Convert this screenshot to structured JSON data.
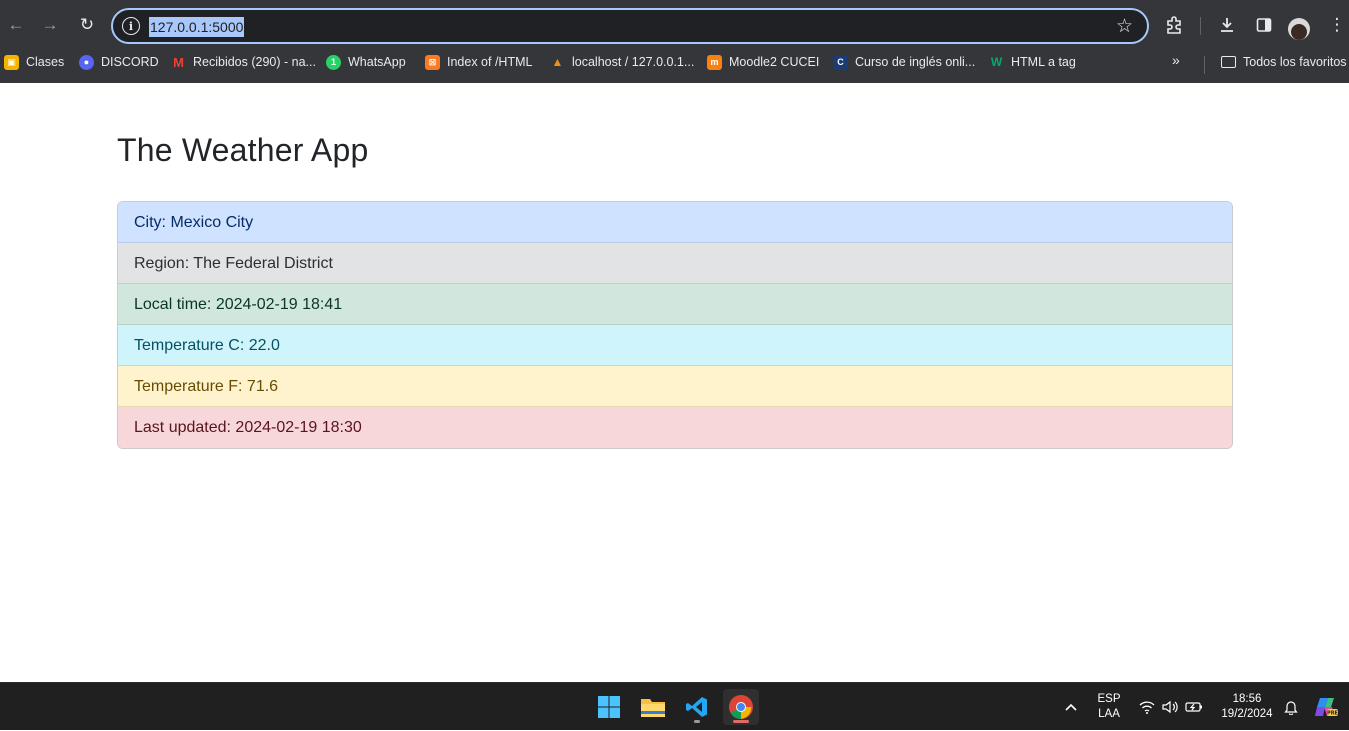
{
  "browser": {
    "url": "127.0.0.1:5000",
    "bookmarks": [
      {
        "label": "Clases",
        "icon": "classroom-icon",
        "color": "#f4b400"
      },
      {
        "label": "DISCORD",
        "icon": "discord-icon",
        "color": "#5865f2"
      },
      {
        "label": "Recibidos (290) - na...",
        "icon": "gmail-icon",
        "color": "#ea4335"
      },
      {
        "label": "WhatsApp",
        "icon": "whatsapp-icon",
        "color": "#25d366"
      },
      {
        "label": "Index of /HTML",
        "icon": "xampp-icon",
        "color": "#fb7a24"
      },
      {
        "label": "localhost / 127.0.0.1...",
        "icon": "phpmyadmin-icon",
        "color": "#f29111"
      },
      {
        "label": "Moodle2 CUCEI",
        "icon": "moodle-icon",
        "color": "#f98012"
      },
      {
        "label": "Curso de inglés onli...",
        "icon": "cambridge-icon",
        "color": "#1a3b73"
      },
      {
        "label": "HTML a tag",
        "icon": "w3schools-icon",
        "color": "#04aa6d"
      }
    ],
    "all_bookmarks_label": "Todos los favoritos"
  },
  "page": {
    "title": "The Weather App",
    "items": [
      {
        "text": "City: Mexico City",
        "variant": "primary"
      },
      {
        "text": "Region: The Federal District",
        "variant": "secondary"
      },
      {
        "text": "Local time: 2024-02-19 18:41",
        "variant": "success"
      },
      {
        "text": "Temperature C: 22.0",
        "variant": "info"
      },
      {
        "text": "Temperature F: 71.6",
        "variant": "warning"
      },
      {
        "text": "Last updated: 2024-02-19 18:30",
        "variant": "danger"
      }
    ]
  },
  "taskbar": {
    "apps": [
      "windows-start-icon",
      "file-explorer-icon",
      "vscode-icon",
      "chrome-icon"
    ],
    "language": {
      "line1": "ESP",
      "line2": "LAA"
    },
    "clock": {
      "time": "18:56",
      "date": "19/2/2024"
    }
  }
}
